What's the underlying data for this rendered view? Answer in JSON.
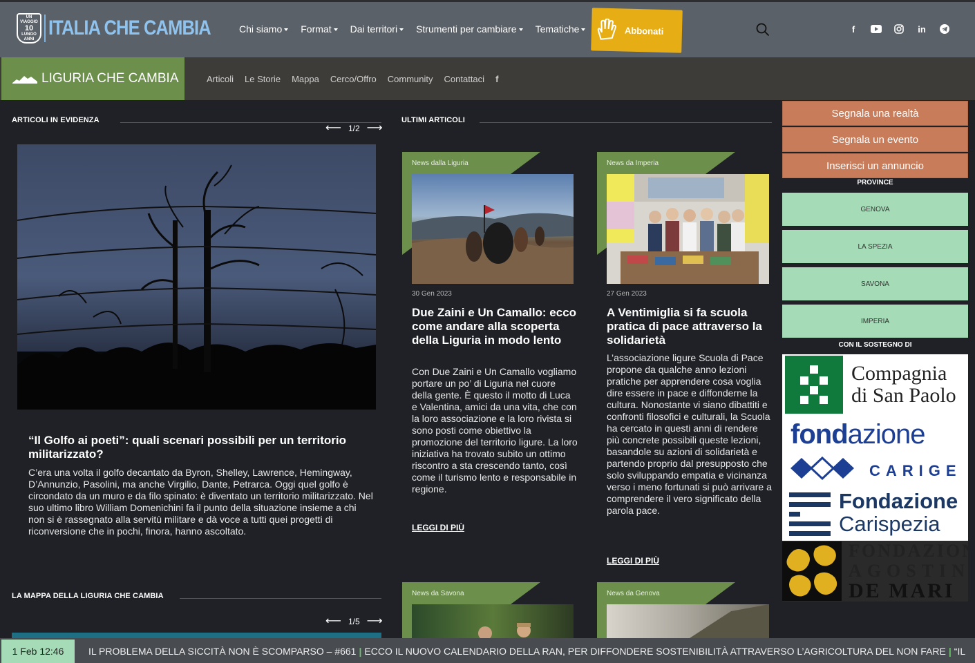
{
  "header": {
    "logo_badge_top": "UN VIAGGIO",
    "logo_badge_num": "10",
    "logo_badge_bottom": "LUNGO ANNI",
    "logo_text": "ITALIA CHE CAMBIA",
    "nav": [
      "Chi siamo",
      "Format",
      "Dai territori",
      "Strumenti per cambiare",
      "Tematiche"
    ],
    "subscribe_label": "Abbonati",
    "accent": "#e6ad14"
  },
  "subheader": {
    "region": "LIGURIA CHE CAMBIA",
    "links": [
      "Articoli",
      "Le Storie",
      "Mappa",
      "Cerco/Offro",
      "Community",
      "Contattaci"
    ],
    "region_color": "#6c8f4c"
  },
  "featured": {
    "heading": "ARTICOLI IN EVIDENZA",
    "pager": "1/2",
    "title": "“Il Golfo ai poeti”: quali scenari possibili per un territorio militarizzato?",
    "description": "C’era una volta il golfo decantato da Byron, Shelley, Lawrence, Hemingway, D’Annunzio, Pasolini, ma anche Virgilio, Dante, Petrarca. Oggi quel golfo è circondato da un muro e da filo spinato: è diventato un territorio militarizzato. Nel suo ultimo libro William Domenichini fa il punto della situazione insieme a chi non si è rassegnato alla servitù militare e dà voce a tutti quei progetti di riconversione che in pochi, finora, hanno ascoltato."
  },
  "map_section": {
    "heading": "LA MAPPA DELLA LIGURIA CHE CAMBIA",
    "pager": "1/5"
  },
  "latest": {
    "heading": "ULTIMI ARTICOLI",
    "articles": [
      {
        "tag": "News dalla Liguria",
        "date": "30 Gen 2023",
        "title": "Due Zaini e Un Camallo: ecco come andare alla scoperta della Liguria in modo lento",
        "description": "Con Due Zaini e Un Camallo vogliamo portare un po’ di Liguria nel cuore della gente. È questo il motto di Luca e Valentina, amici da una vita, che con la loro associazione e la loro rivista si sono posti come obiettivo la promozione del territorio ligure. La loro iniziativa ha trovato subito un ottimo riscontro a sta crescendo tanto, così come il turismo lento e responsabile in regione.",
        "read_more": "LEGGI DI PIÙ"
      },
      {
        "tag": "News da Imperia",
        "date": "27 Gen 2023",
        "title": "A Ventimiglia si fa scuola pratica di pace attraverso la solidarietà",
        "description": "L’associazione ligure Scuola di Pace propone da qualche anno lezioni pratiche per apprendere cosa voglia dire essere in pace e diffonderne la cultura. Nonostante vi siano dibattiti e confronti filosofici e culturali, la Scuola ha cercato in questi anni di rendere più concrete possibili queste lezioni, basandole su azioni di solidarietà e partendo proprio dal presupposto che solo sviluppando empatia e vicinanza verso i meno fortunati si può arrivare a comprendere il vero significato della parola pace.",
        "read_more": "LEGGI DI PIÙ"
      },
      {
        "tag": "News da Savona"
      },
      {
        "tag": "News da Genova"
      }
    ]
  },
  "sidebar": {
    "buttons": [
      "Segnala una realtà",
      "Segnala un evento",
      "Inserisci un annuncio"
    ],
    "provinces_heading": "PROVINCE",
    "provinces": [
      "GENOVA",
      "LA SPEZIA",
      "SAVONA",
      "IMPERIA"
    ],
    "sponsors_heading": "CON IL SOSTEGNO DI",
    "sponsors": {
      "s1_line1": "Compagnia",
      "s1_line2": "di San Paolo",
      "s2_bold": "fond",
      "s2_rest": "azione",
      "s2_sub": "CARIGE",
      "s3_line1": "Fondazione",
      "s3_line2": "Carispezia",
      "s4_line1": "FONDAZIONE",
      "s4_line2": "AGOSTINO",
      "s4_line3": "DE MARI"
    }
  },
  "ticker": {
    "time": "1 Feb 12:46",
    "items": [
      "IL PROBLEMA DELLA SICCITÀ NON È SCOMPARSO – #661",
      "ECCO IL NUOVO CALENDARIO DELLA RAN, PER DIFFONDERE SOSTENIBILITÀ ATTRAVERSO L’AGRICOLTURA DEL NON FARE",
      "“IL"
    ]
  }
}
